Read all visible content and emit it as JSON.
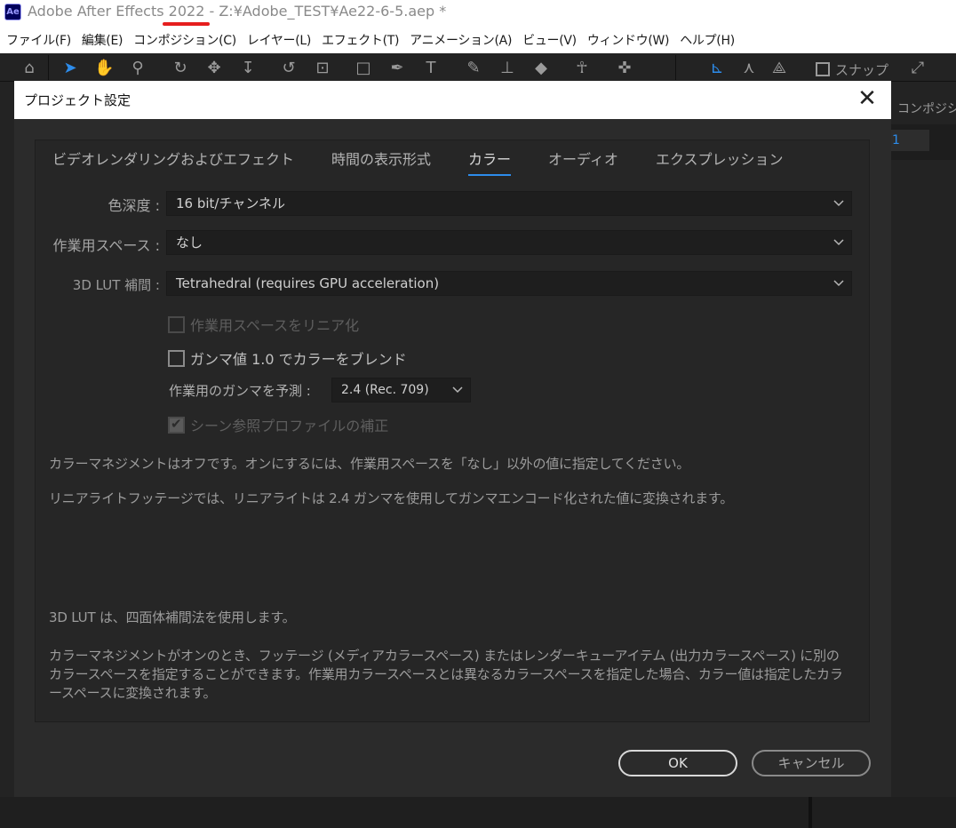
{
  "window": {
    "app_icon": "Ae",
    "title": "Adobe After Effects 2022 - Z:¥Adobe_TEST¥Ae22-6-5.aep *",
    "underline_color": "#e61e1e"
  },
  "menubar": {
    "items": [
      "ファイル(F)",
      "編集(E)",
      "コンポジション(C)",
      "レイヤー(L)",
      "エフェクト(T)",
      "アニメーション(A)",
      "ビュー(V)",
      "ウィンドウ(W)",
      "ヘルプ(H)"
    ]
  },
  "toolbar": {
    "snap_label": "スナップ"
  },
  "right_panel": {
    "tab_text": "コンポジシ",
    "field_value": "1"
  },
  "dialog": {
    "title": "プロジェクト設定",
    "close_glyph": "✕",
    "tabs": [
      {
        "label": "ビデオレンダリングおよびエフェクト",
        "active": false
      },
      {
        "label": "時間の表示形式",
        "active": false
      },
      {
        "label": "カラー",
        "active": true
      },
      {
        "label": "オーディオ",
        "active": false
      },
      {
        "label": "エクスプレッション",
        "active": false
      }
    ],
    "color_depth": {
      "label": "色深度 :",
      "value": "16 bit/チャンネル"
    },
    "working_space": {
      "label": "作業用スペース :",
      "value": "なし"
    },
    "lut_interp": {
      "label": "3D LUT 補間 :",
      "value": "Tetrahedral (requires GPU acceleration)"
    },
    "checkboxes": {
      "linearize": {
        "label": "作業用スペースをリニア化",
        "checked": false,
        "enabled": false
      },
      "blend_gamma": {
        "label": "ガンマ値 1.0 でカラーをブレンド",
        "checked": false,
        "enabled": true
      },
      "scene_profile": {
        "label": "シーン参照プロファイルの補正",
        "checked": true,
        "enabled": false
      }
    },
    "gamma_predict": {
      "label": "作業用のガンマを予測 :",
      "value": "2.4 (Rec. 709)"
    },
    "info": {
      "line1": "カラーマネジメントはオフです。オンにするには、作業用スペースを「なし」以外の値に指定してください。",
      "line2": "リニアライトフッテージでは、リニアライトは 2.4 ガンマを使用してガンマエンコード化された値に変換されます。",
      "line3": "3D LUT は、四面体補間法を使用します。",
      "line4": "カラーマネジメントがオンのとき、フッテージ (メディアカラースペース) またはレンダーキューアイテム (出力カラースペース) に別のカラースペースを指定することができます。作業用カラースペースとは異なるカラースペースを指定した場合、カラー値は指定したカラースペースに変換されます。"
    },
    "buttons": {
      "ok": "OK",
      "cancel": "キャンセル"
    },
    "accent_color": "#2d8ceb"
  }
}
